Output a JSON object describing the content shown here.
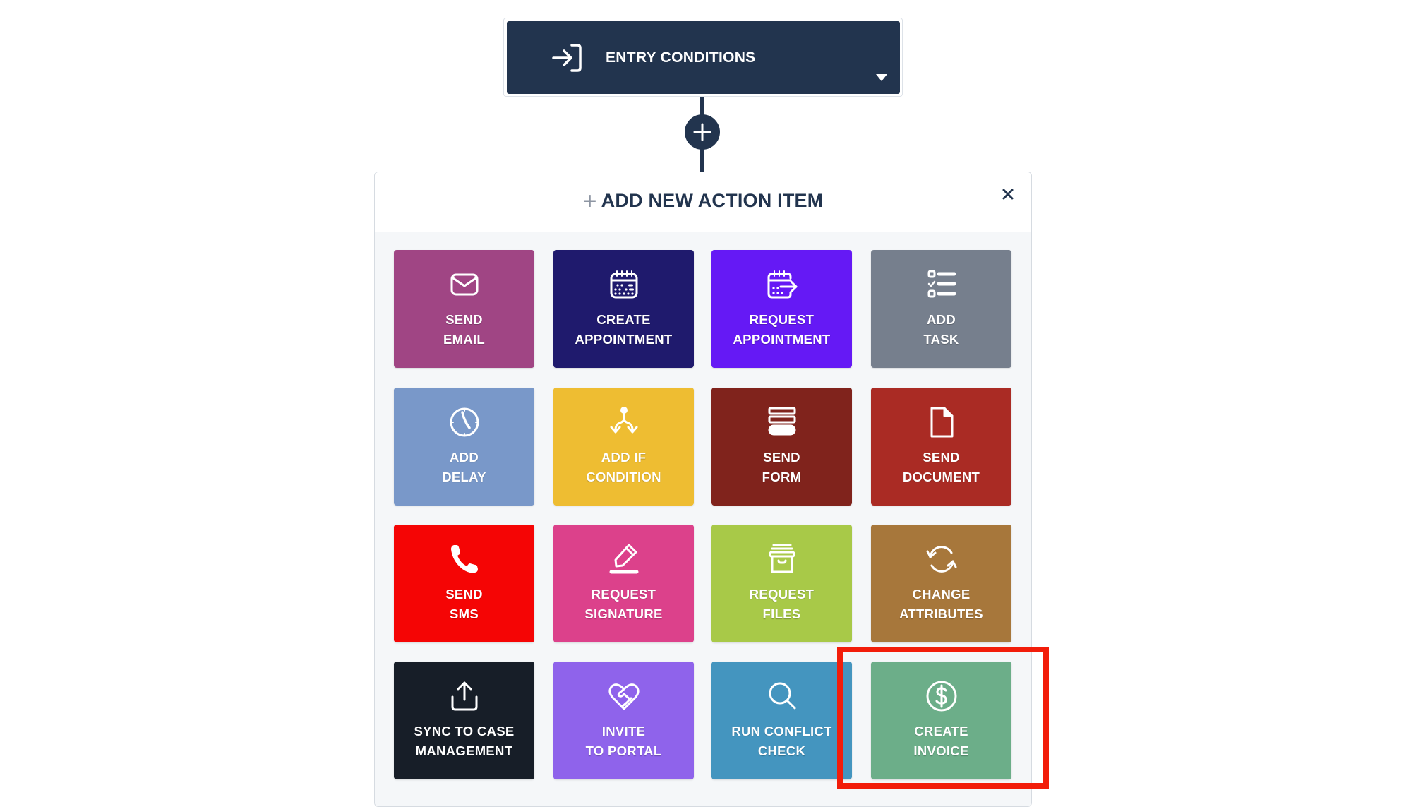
{
  "entry_conditions": {
    "label": "ENTRY CONDITIONS",
    "icon": "sign-in-icon",
    "dropdown_icon": "caret-down-icon"
  },
  "add_step_button": {
    "icon": "plus-icon"
  },
  "panel": {
    "title": "ADD NEW ACTION ITEM",
    "title_icon": "plus-icon",
    "close_icon": "close-icon",
    "close_glyph": "×",
    "plus_glyph": "+"
  },
  "actions": [
    {
      "id": "send-email",
      "line1": "SEND",
      "line2": "EMAIL",
      "icon": "envelope-icon",
      "color": "#a04584"
    },
    {
      "id": "create-appointment",
      "line1": "CREATE",
      "line2": "APPOINTMENT",
      "icon": "calendar-icon",
      "color": "#1f1a6d"
    },
    {
      "id": "request-appointment",
      "line1": "REQUEST",
      "line2": "APPOINTMENT",
      "icon": "calendar-arrow-icon",
      "color": "#6519f5"
    },
    {
      "id": "add-task",
      "line1": "ADD",
      "line2": "TASK",
      "icon": "checklist-icon",
      "color": "#767f8d"
    },
    {
      "id": "add-delay",
      "line1": "ADD",
      "line2": "DELAY",
      "icon": "clock-icon",
      "color": "#7998c9"
    },
    {
      "id": "add-if-condition",
      "line1": "ADD IF",
      "line2": "CONDITION",
      "icon": "branch-icon",
      "color": "#eebd32"
    },
    {
      "id": "send-form",
      "line1": "SEND",
      "line2": "FORM",
      "icon": "form-icon",
      "color": "#80231c"
    },
    {
      "id": "send-document",
      "line1": "SEND",
      "line2": "DOCUMENT",
      "icon": "document-icon",
      "color": "#aa2b24"
    },
    {
      "id": "send-sms",
      "line1": "SEND",
      "line2": "SMS",
      "icon": "phone-icon",
      "color": "#f50505"
    },
    {
      "id": "request-signature",
      "line1": "REQUEST",
      "line2": "SIGNATURE",
      "icon": "pen-icon",
      "color": "#dc418b"
    },
    {
      "id": "request-files",
      "line1": "REQUEST",
      "line2": "FILES",
      "icon": "archive-box-icon",
      "color": "#a8c948"
    },
    {
      "id": "change-attributes",
      "line1": "CHANGE",
      "line2": "ATTRIBUTES",
      "icon": "refresh-icon",
      "color": "#a7773b"
    },
    {
      "id": "sync-to-case-management",
      "line1": "SYNC TO CASE",
      "line2": "MANAGEMENT",
      "icon": "upload-icon",
      "color": "#171e28"
    },
    {
      "id": "invite-to-portal",
      "line1": "INVITE",
      "line2": "TO PORTAL",
      "icon": "handshake-icon",
      "color": "#8f63eb"
    },
    {
      "id": "run-conflict-check",
      "line1": "RUN CONFLICT",
      "line2": "CHECK",
      "icon": "search-icon",
      "color": "#4495bf"
    },
    {
      "id": "create-invoice",
      "line1": "CREATE",
      "line2": "INVOICE",
      "icon": "dollar-circle-icon",
      "color": "#6cae89",
      "highlighted": true
    }
  ],
  "highlight_color": "#f21d0a"
}
